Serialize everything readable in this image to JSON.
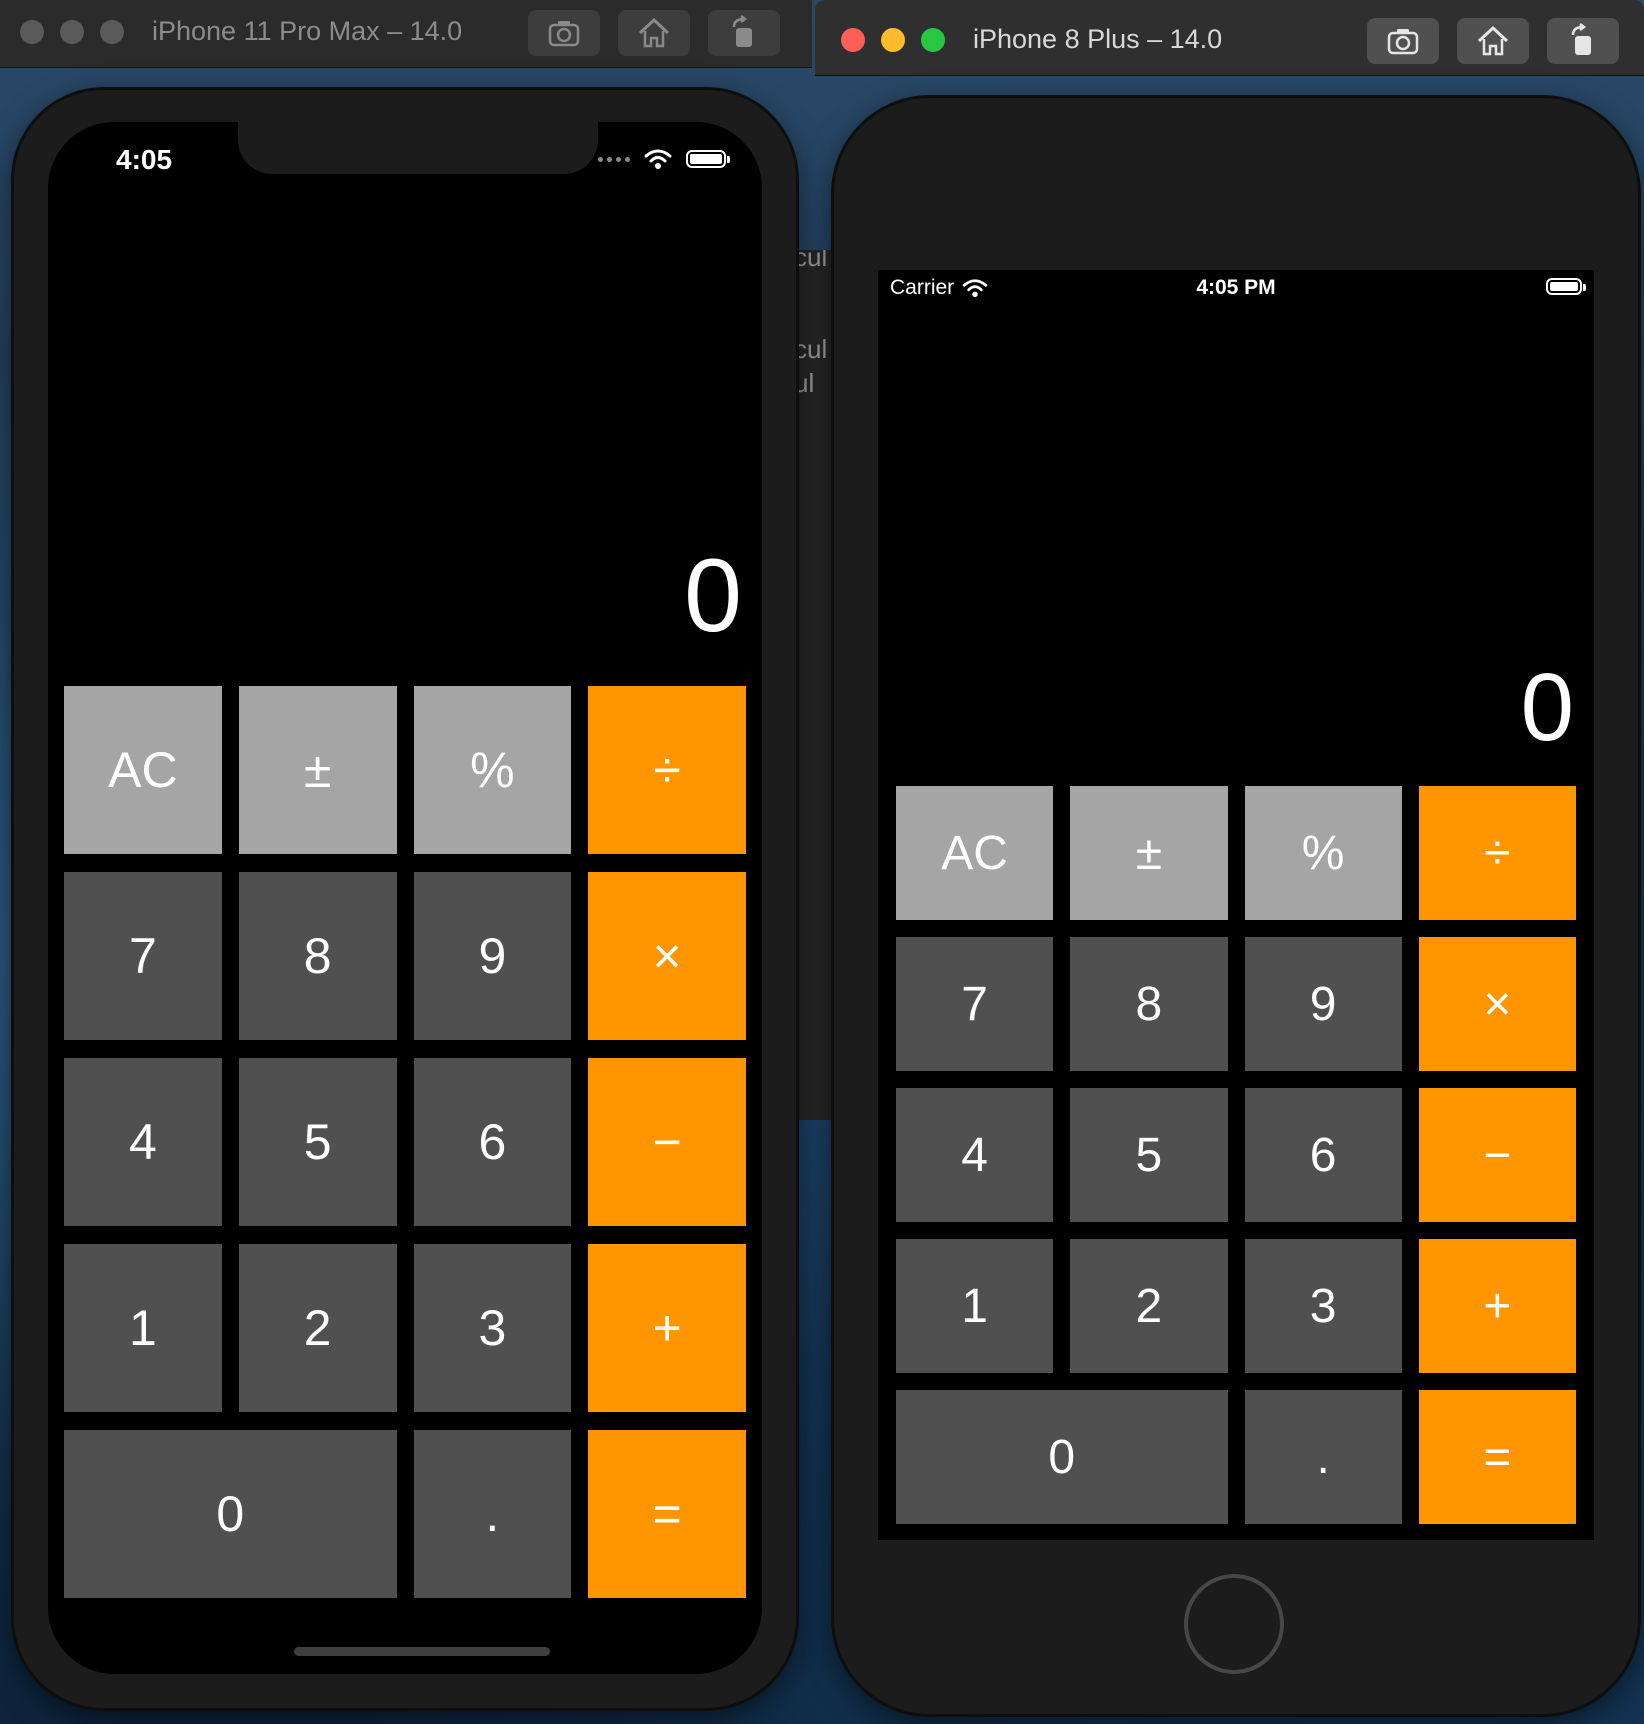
{
  "left_window": {
    "title": "iPhone 11 Pro Max – 14.0",
    "toolbar": {
      "screenshot_icon": "camera-icon",
      "home_icon": "home-icon",
      "rotate_icon": "rotate-icon"
    }
  },
  "right_window": {
    "title": "iPhone 8 Plus – 14.0",
    "toolbar": {
      "screenshot_icon": "camera-icon",
      "home_icon": "home-icon",
      "rotate_icon": "rotate-icon"
    }
  },
  "background_window": {
    "fragments": [
      "cul",
      "cul",
      "ul"
    ]
  },
  "left_device": {
    "status": {
      "time": "4:05"
    },
    "calculator": {
      "display": "0"
    }
  },
  "right_device": {
    "status": {
      "carrier": "Carrier",
      "time": "4:05 PM"
    },
    "calculator": {
      "display": "0"
    }
  },
  "keypad": {
    "keys": [
      {
        "label": "AC",
        "type": "fn"
      },
      {
        "label": "±",
        "type": "fn"
      },
      {
        "label": "%",
        "type": "fn"
      },
      {
        "label": "÷",
        "type": "op"
      },
      {
        "label": "7",
        "type": "num"
      },
      {
        "label": "8",
        "type": "num"
      },
      {
        "label": "9",
        "type": "num"
      },
      {
        "label": "×",
        "type": "op"
      },
      {
        "label": "4",
        "type": "num"
      },
      {
        "label": "5",
        "type": "num"
      },
      {
        "label": "6",
        "type": "num"
      },
      {
        "label": "−",
        "type": "op"
      },
      {
        "label": "1",
        "type": "num"
      },
      {
        "label": "2",
        "type": "num"
      },
      {
        "label": "3",
        "type": "num"
      },
      {
        "label": "+",
        "type": "op"
      },
      {
        "label": "0",
        "type": "num"
      },
      {
        "label": ".",
        "type": "num"
      },
      {
        "label": "=",
        "type": "op"
      }
    ]
  },
  "colors": {
    "function_key": "#a5a5a5",
    "number_key": "#505050",
    "operator_key": "#ff9500",
    "display_text": "#ffffff"
  }
}
